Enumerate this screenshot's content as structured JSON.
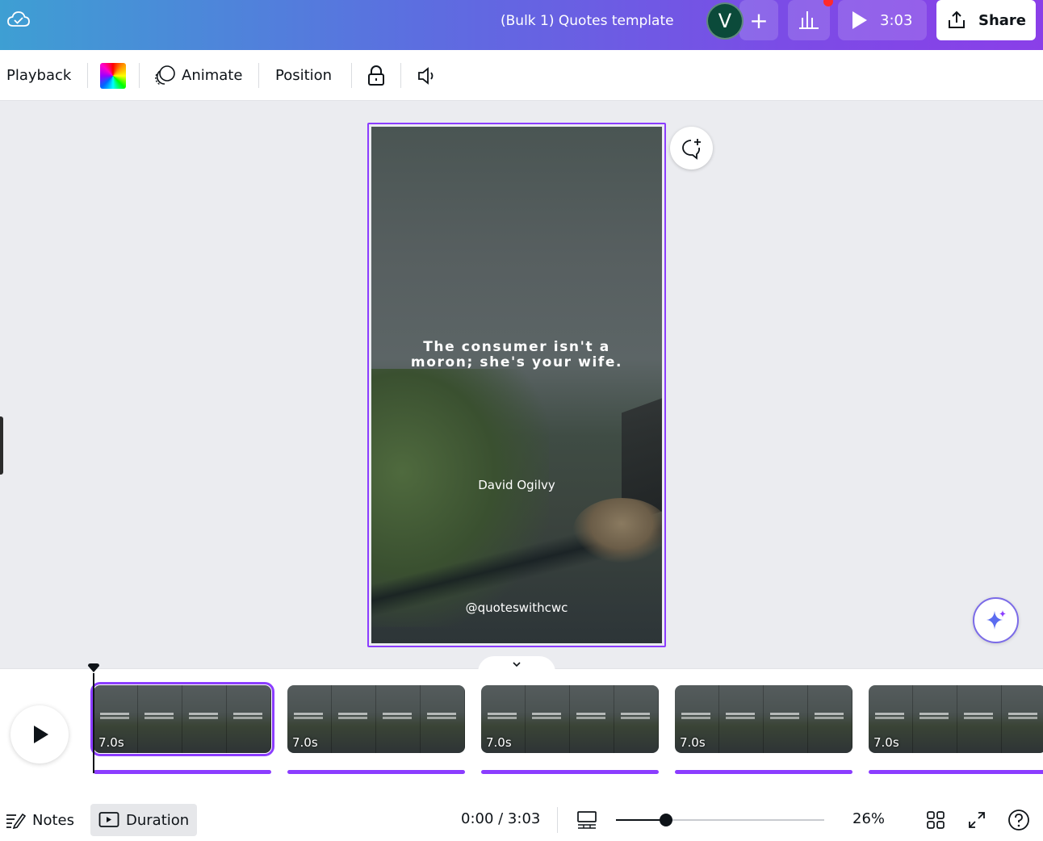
{
  "header": {
    "title": "(Bulk 1) Quotes template",
    "avatar_initial": "V",
    "add_label": "+",
    "present_duration": "3:03",
    "share_label": "Share"
  },
  "toolbar": {
    "playback_label": "Playback",
    "animate_label": "Animate",
    "position_label": "Position"
  },
  "design": {
    "quote_line1": "The consumer isn't a",
    "quote_line2": "moron; she's your wife.",
    "author": "David Ogilvy",
    "handle": "@quoteswithcwc"
  },
  "timeline": {
    "clips": [
      {
        "duration": "7.0s",
        "selected": true
      },
      {
        "duration": "7.0s",
        "selected": false
      },
      {
        "duration": "7.0s",
        "selected": false
      },
      {
        "duration": "7.0s",
        "selected": false
      },
      {
        "duration": "7.0s",
        "selected": false
      }
    ]
  },
  "footer": {
    "notes_label": "Notes",
    "duration_label": "Duration",
    "time": "0:00 / 3:03",
    "zoom_slider_fraction": 0.24,
    "zoom": "26%"
  },
  "colors": {
    "accent": "#8b3dff",
    "avatar_bg": "#0b4a3a",
    "notification": "#ff2a2a"
  },
  "icons": [
    "cloud-sync-icon",
    "bar-chart-icon",
    "play-icon",
    "share-icon",
    "color-palette-icon",
    "animate-icon",
    "lock-icon",
    "volume-icon",
    "add-comment-icon",
    "magic-sparkle-icon",
    "chevron-down-icon",
    "notes-icon",
    "duration-icon",
    "page-layout-icon",
    "grid-view-icon",
    "fullscreen-icon",
    "help-icon"
  ]
}
